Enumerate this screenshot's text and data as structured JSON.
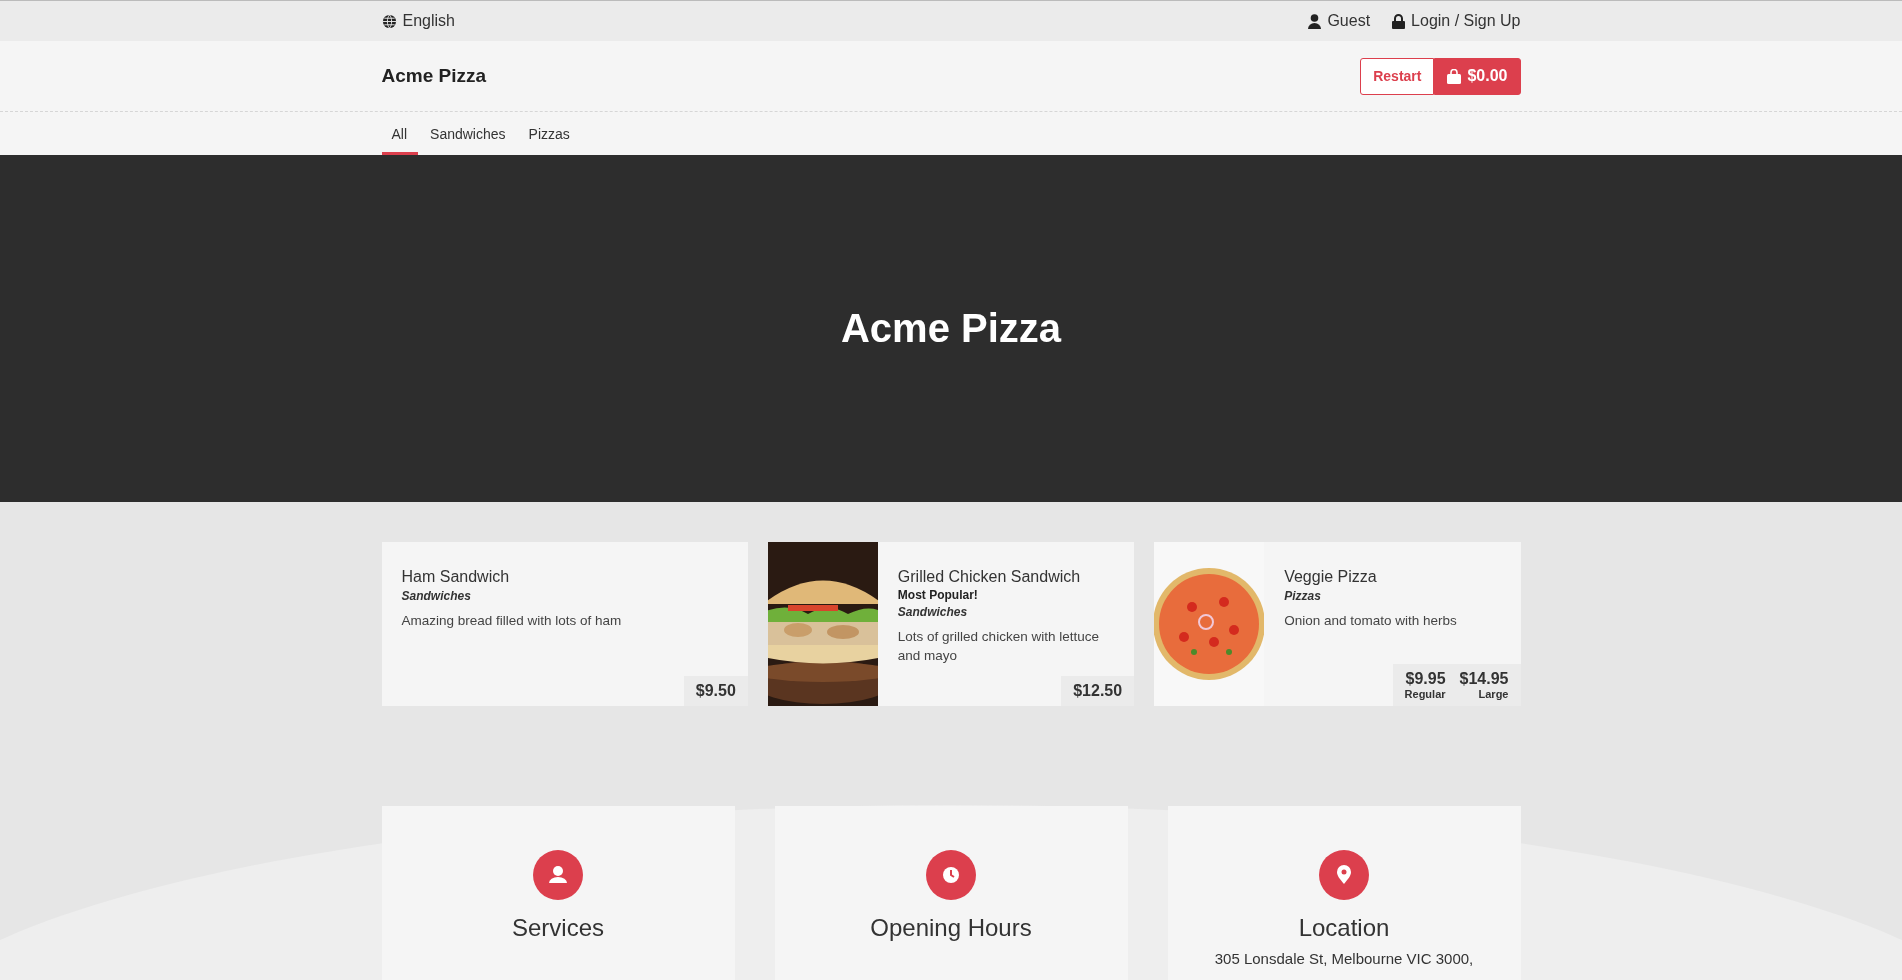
{
  "top_bar": {
    "language": "English",
    "user": "Guest",
    "login": "Login / Sign Up"
  },
  "header": {
    "brand": "Acme Pizza",
    "restart_button": "Restart",
    "cart_button": "$0.00"
  },
  "tabs": [
    {
      "label": "All",
      "selected": true
    },
    {
      "label": "Sandwiches",
      "selected": false
    },
    {
      "label": "Pizzas",
      "selected": false
    }
  ],
  "hero": {
    "title": "Acme Pizza"
  },
  "products": [
    {
      "name": "Ham Sandwich",
      "category": "Sandwiches",
      "description": "Amazing bread filled with lots of ham",
      "prices": [
        {
          "price": "$9.50"
        }
      ]
    },
    {
      "name": "Grilled Chicken Sandwich",
      "badge": "Most Popular!",
      "category": "Sandwiches",
      "description": "Lots of grilled chicken with lettuce and mayo",
      "image": {
        "kind": "sandwich"
      },
      "prices": [
        {
          "price": "$12.50"
        }
      ]
    },
    {
      "name": "Veggie Pizza",
      "category": "Pizzas",
      "description": "Onion and tomato with herbs",
      "image": {
        "kind": "pizza"
      },
      "prices": [
        {
          "price": "$9.95",
          "label": "Regular"
        },
        {
          "price": "$14.95",
          "label": "Large"
        }
      ]
    }
  ],
  "info_cards": [
    {
      "kind": "services",
      "title": "Services"
    },
    {
      "kind": "hours",
      "title": "Opening Hours"
    },
    {
      "kind": "location",
      "title": "Location",
      "text": "305 Lonsdale St, Melbourne VIC 3000,"
    }
  ]
}
